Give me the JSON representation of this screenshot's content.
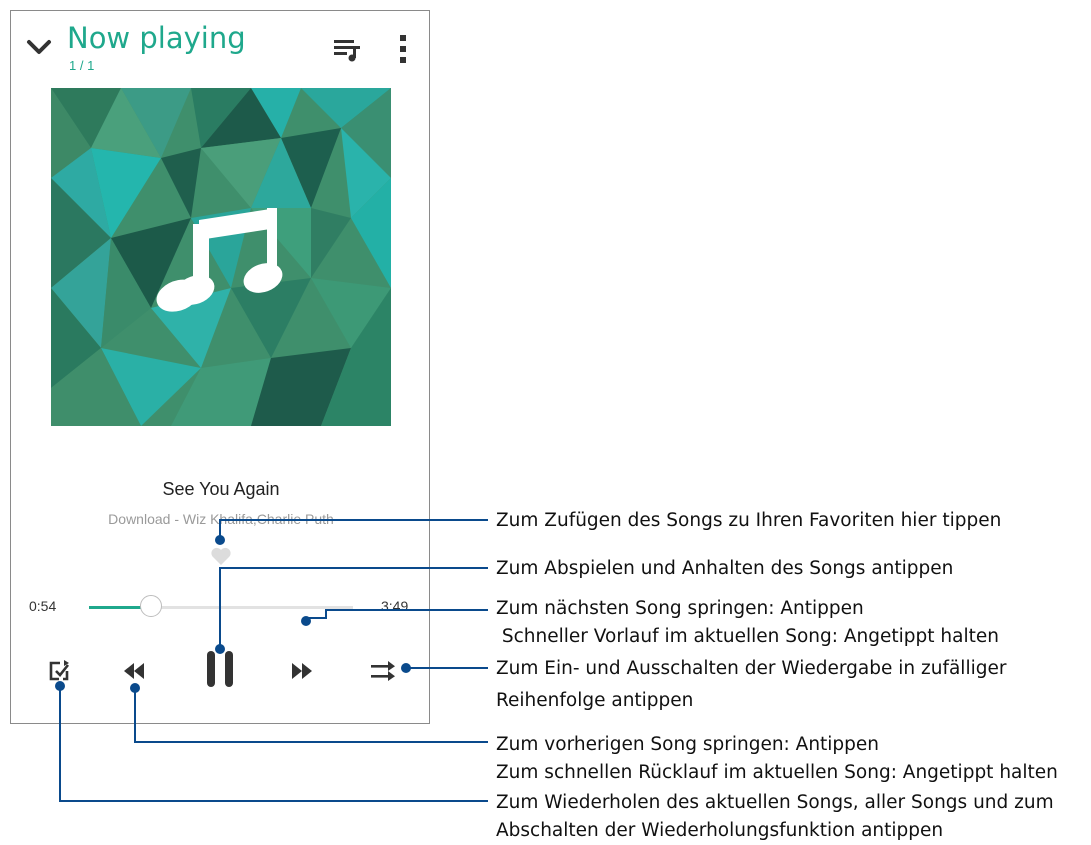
{
  "header": {
    "title": "Now playing",
    "track_count": "1 / 1",
    "back_icon": "chevron-down-icon",
    "queue_icon": "queue-music-icon",
    "more_icon": "more-vert-icon"
  },
  "track": {
    "title": "See You Again",
    "subtitle": "Download - Wiz Khalifa,Charlie Puth"
  },
  "progress": {
    "current": "0:54",
    "total": "3:49",
    "fraction": 0.236
  },
  "controls": [
    "repeat-icon",
    "rewind-icon",
    "pause-icon",
    "fast-forward-icon",
    "shuffle-icon"
  ],
  "colors": {
    "accent": "#1fa88c",
    "callout": "#0a4a8c",
    "controls": "#333333"
  },
  "annotations": {
    "favorite": "Zum Zufügen des Songs zu Ihren Favoriten hier tippen",
    "play_pause": "Zum Abspielen und Anhalten des Songs antippen",
    "next_line1": "Zum nächsten Song springen: Antippen",
    "next_line2": " Schneller Vorlauf im aktuellen Song: Angetippt halten",
    "shuffle_line1": "Zum Ein- und Ausschalten der Wiedergabe in zufälliger",
    "shuffle_line2": "Reihenfolge antippen",
    "prev_line1": "Zum vorherigen Song springen: Antippen",
    "prev_line2": "Zum schnellen Rücklauf im aktuellen Song: Angetippt halten",
    "repeat_line1": "Zum Wiederholen des aktuellen Songs, aller Songs und zum",
    "repeat_line2": "Abschalten der Wiederholungsfunktion antippen"
  }
}
